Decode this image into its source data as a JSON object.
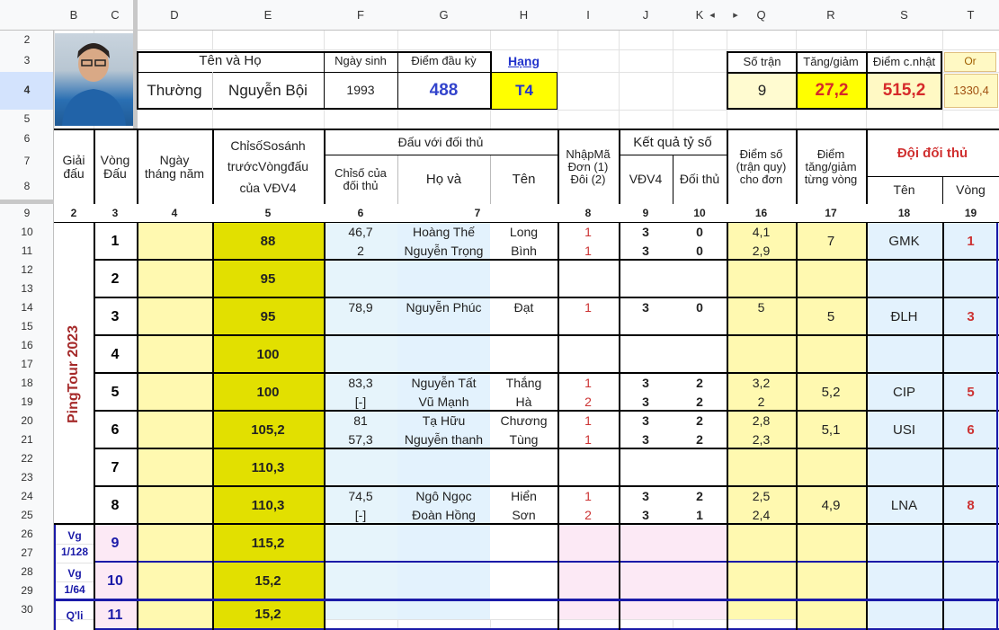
{
  "columns": [
    "B",
    "C",
    "D",
    "E",
    "F",
    "G",
    "H",
    "I",
    "J",
    "K",
    "Q",
    "R",
    "S",
    "T"
  ],
  "row_numbers": [
    "2",
    "3",
    "4",
    "5",
    "6",
    "7",
    "8",
    "9",
    "10",
    "11",
    "12",
    "13",
    "14",
    "15",
    "16",
    "17",
    "18",
    "19",
    "20",
    "21",
    "22",
    "23",
    "24",
    "25",
    "26",
    "27",
    "28",
    "29",
    "30"
  ],
  "col_toggle_icons": [
    "◂",
    "▸"
  ],
  "avatar_desc": "avatar-photo",
  "top": {
    "ten_va_ho": "Tên     và     Họ",
    "ngay_sinh_label": "Ngày sinh",
    "diem_dau_ky_label": "Điểm đầu kỳ",
    "hang_label": "Hạng",
    "ten": "Thường",
    "ho": "Nguyễn Bội",
    "ngay_sinh": "1993",
    "diem_dau_ky": "488",
    "hang": "T4",
    "so_tran_label": "Số trận",
    "tang_giam_label": "Tăng/giảm",
    "diem_cnhat_label": "Điểm c.nhật",
    "or_label": "Or",
    "so_tran": "9",
    "tang_giam": "27,2",
    "diem_cnhat": "515,2",
    "or": "1330,4"
  },
  "headers": {
    "giai_dau": "Giải đấu",
    "vong_dau": "Vòng Đấu",
    "ngay_thang_nam": "Ngày tháng năm",
    "chiso_ss": "ChỉsốSosánh trướcVòngđấu của VĐV4",
    "dau_voi_doi_thu": "Đấu với đối thủ",
    "chiso_doi_thu": "Chỉsố của đối thủ",
    "ho_va": "Họ      và",
    "ten": "Tên",
    "nhap_ma": "NhậpMã Đơn (1) Đôi (2)",
    "ket_qua": "Kết quả tỷ số",
    "vdv4": "VĐV4",
    "doi_thu": "Đối thủ",
    "diem_so": "Điểm số (trận quy) cho đơn",
    "diem_tg": "Điểm tăng/giảm từng vòng",
    "doi_doi_thu": "Đội đối thủ",
    "s_ten": "Tên",
    "t_vong": "Vòng"
  },
  "num_row": [
    "2",
    "3",
    "4",
    "5",
    "6",
    "7",
    "8",
    "9",
    "10",
    "16",
    "17",
    "18",
    "19"
  ],
  "giai_dau_vertical": "PingTour 2023",
  "rounds": [
    {
      "vong": "1",
      "chiso": "88",
      "sub": [
        [
          "46,7",
          "Hoàng Thế",
          "Long",
          "1",
          "3",
          "0",
          "4,1"
        ],
        [
          "2",
          "Nguyễn Trọng",
          "Bình",
          "1",
          "3",
          "0",
          "2,9"
        ]
      ],
      "tg": "7",
      "team": "GMK",
      "tv": "1"
    },
    {
      "vong": "2",
      "chiso": "95",
      "sub": [
        [
          "",
          "",
          "",
          "",
          "",
          "",
          ""
        ],
        [
          "",
          "",
          "",
          "",
          "",
          "",
          ""
        ]
      ],
      "tg": "",
      "team": "",
      "tv": ""
    },
    {
      "vong": "3",
      "chiso": "95",
      "sub": [
        [
          "78,9",
          "Nguyễn Phúc",
          "Đạt",
          "1",
          "3",
          "0",
          "5"
        ],
        [
          "",
          "",
          "",
          "",
          "",
          "",
          ""
        ]
      ],
      "tg": "5",
      "team": "ĐLH",
      "tv": "3"
    },
    {
      "vong": "4",
      "chiso": "100",
      "sub": [
        [
          "",
          "",
          "",
          "",
          "",
          "",
          ""
        ],
        [
          "",
          "",
          "",
          "",
          "",
          "",
          ""
        ]
      ],
      "tg": "",
      "team": "",
      "tv": ""
    },
    {
      "vong": "5",
      "chiso": "100",
      "sub": [
        [
          "83,3",
          "Nguyễn Tất",
          "Thắng",
          "1",
          "3",
          "2",
          "3,2"
        ],
        [
          "[-]",
          "Vũ Mạnh",
          "Hà",
          "2",
          "3",
          "2",
          "2"
        ]
      ],
      "tg": "5,2",
      "team": "CIP",
      "tv": "5"
    },
    {
      "vong": "6",
      "chiso": "105,2",
      "sub": [
        [
          "81",
          "Tạ Hữu",
          "Chương",
          "1",
          "3",
          "2",
          "2,8"
        ],
        [
          "57,3",
          "Nguyễn thanh",
          "Tùng",
          "1",
          "3",
          "2",
          "2,3"
        ]
      ],
      "tg": "5,1",
      "team": "USI",
      "tv": "6"
    },
    {
      "vong": "7",
      "chiso": "110,3",
      "sub": [
        [
          "",
          "",
          "",
          "",
          "",
          "",
          ""
        ],
        [
          "",
          "",
          "",
          "",
          "",
          "",
          ""
        ]
      ],
      "tg": "",
      "team": "",
      "tv": ""
    },
    {
      "vong": "8",
      "chiso": "110,3",
      "sub": [
        [
          "74,5",
          "Ngô Ngọc",
          "Hiển",
          "1",
          "3",
          "2",
          "2,5"
        ],
        [
          "[-]",
          "Đoàn Hồng",
          "Sơn",
          "2",
          "3",
          "1",
          "2,4"
        ]
      ],
      "tg": "4,9",
      "team": "LNA",
      "tv": "8"
    },
    {
      "vong": "9",
      "chiso": "115,2",
      "giai": "Vg 1/128",
      "sub": [
        [
          "",
          "",
          "",
          "",
          "",
          "",
          ""
        ],
        [
          "",
          "",
          "",
          "",
          "",
          "",
          ""
        ]
      ],
      "tg": "",
      "team": "",
      "tv": ""
    },
    {
      "vong": "10",
      "chiso": "15,2",
      "giai": "Vg 1/64",
      "sub": [
        [
          "",
          "",
          "",
          "",
          "",
          "",
          ""
        ],
        [
          "",
          "",
          "",
          "",
          "",
          "",
          ""
        ]
      ],
      "tg": "",
      "team": "",
      "tv": ""
    },
    {
      "vong": "11",
      "chiso": "15,2",
      "giai": "Q'li",
      "sub": [
        [
          "",
          "",
          "",
          "",
          "",
          "",
          ""
        ]
      ],
      "tg": "",
      "team": "",
      "tv": ""
    }
  ],
  "colors": {
    "yellow": "#fff9b0",
    "darkyellow": "#e8e000",
    "lightblue": "#e3f2fd",
    "pink": "#fce9f5",
    "red": "#cc3333",
    "navy": "#1a1aa8",
    "brightyellow": "#ffff00"
  }
}
